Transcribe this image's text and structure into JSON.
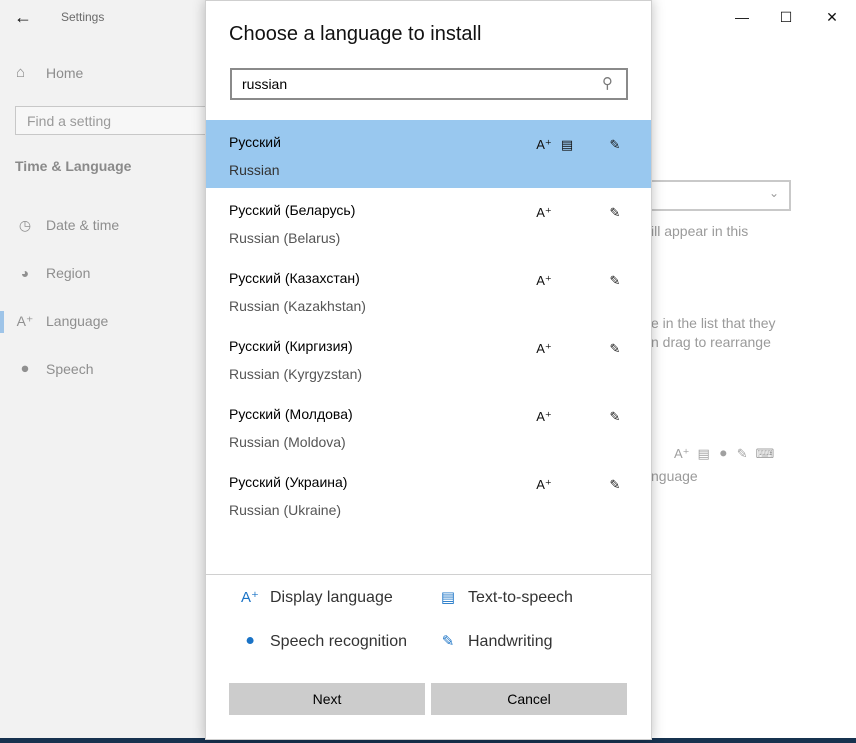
{
  "settings": {
    "title": "Settings",
    "home": "Home",
    "search_placeholder": "Find a setting",
    "section": "Time & Language",
    "nav": [
      {
        "label": "Date & time",
        "icon": "calendar-clock-icon"
      },
      {
        "label": "Region",
        "icon": "globe-icon"
      },
      {
        "label": "Language",
        "icon": "language-icon"
      },
      {
        "label": "Speech",
        "icon": "microphone-icon"
      }
    ],
    "background_text": {
      "line1": "ill appear in this",
      "line2": "e in the list that they",
      "line3": "n drag to rearrange",
      "line4": "nguage"
    }
  },
  "dialog": {
    "title": "Choose a language to install",
    "search_value": "russian",
    "results": [
      {
        "native": "Русский",
        "english": "Russian",
        "selected": true
      },
      {
        "native": "Русский (Беларусь)",
        "english": "Russian (Belarus)"
      },
      {
        "native": "Русский (Казахстан)",
        "english": "Russian (Kazakhstan)"
      },
      {
        "native": "Русский (Киргизия)",
        "english": "Russian (Kyrgyzstan)"
      },
      {
        "native": "Русский (Молдова)",
        "english": "Russian (Moldova)"
      },
      {
        "native": "Русский (Украина)",
        "english": "Russian (Ukraine)"
      }
    ],
    "legend": {
      "display": "Display language",
      "tts": "Text-to-speech",
      "speech": "Speech recognition",
      "handwriting": "Handwriting"
    },
    "buttons": {
      "next": "Next",
      "cancel": "Cancel"
    }
  },
  "colors": {
    "selected_row": "#99c8ef",
    "accent_icon": "#1a73c6",
    "button": "#cccccc"
  }
}
